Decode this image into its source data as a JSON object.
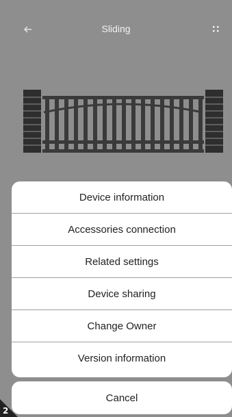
{
  "header": {
    "back_icon": "arrow-left-icon",
    "title": "Sliding",
    "more_icon": "four-dots-menu-icon"
  },
  "device_image": "sliding-gate-icon",
  "menu": {
    "items": [
      {
        "label": "Device information"
      },
      {
        "label": "Accessories connection"
      },
      {
        "label": "Related settings"
      },
      {
        "label": "Device sharing"
      },
      {
        "label": "Change Owner"
      },
      {
        "label": "Version information"
      }
    ],
    "cancel_label": "Cancel"
  },
  "corner_badge": {
    "number": "2"
  },
  "colors": {
    "backdrop": "#8e8e8e",
    "sheet": "#ffffff",
    "gate": "#3a3a3a"
  }
}
